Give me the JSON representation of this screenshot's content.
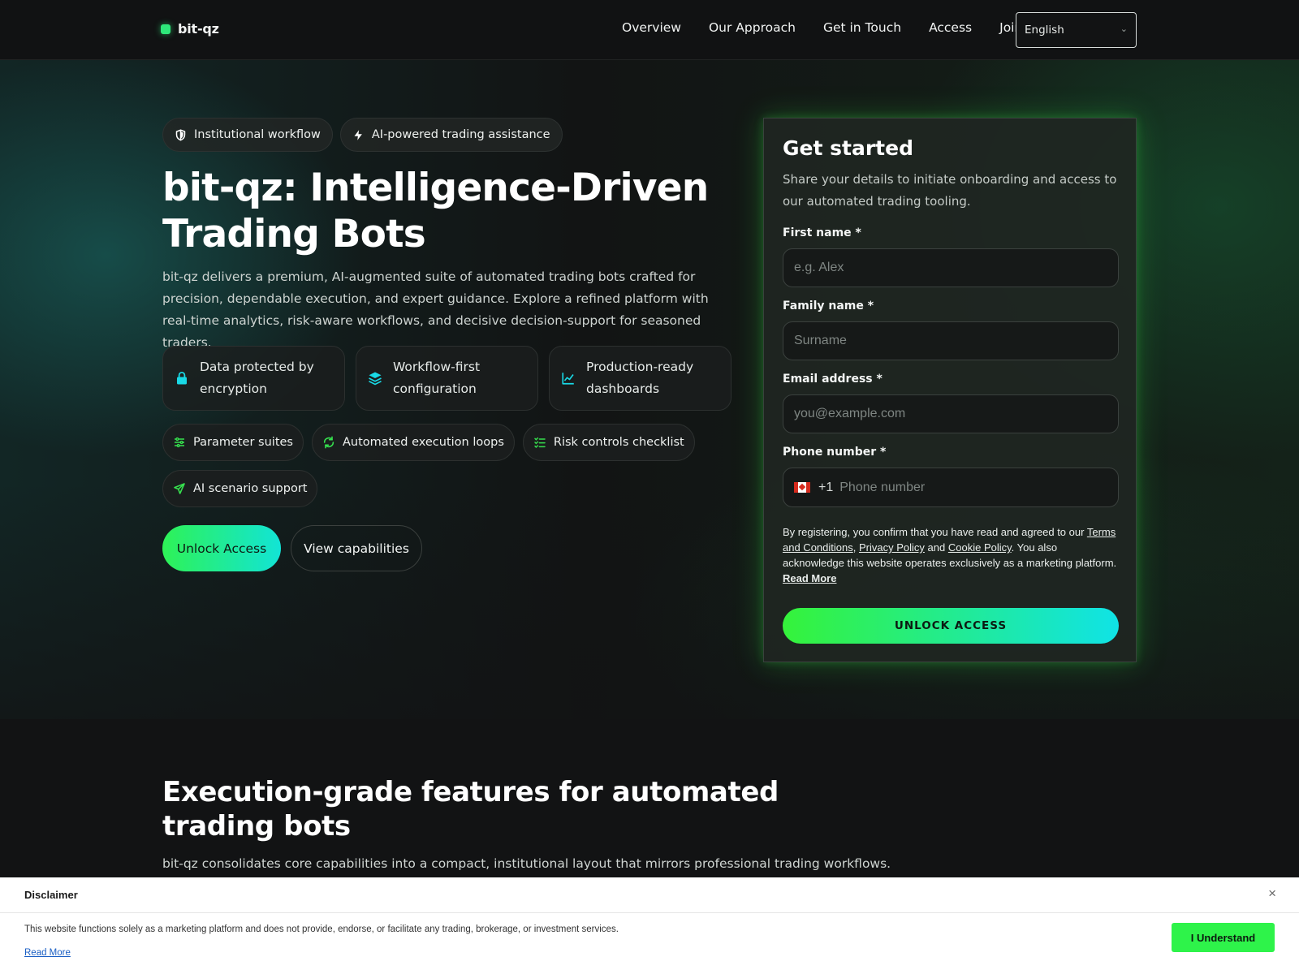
{
  "nav": {
    "brand": "bit-qz",
    "links": [
      "Overview",
      "Our Approach",
      "Get in Touch",
      "Access",
      "Join"
    ],
    "language": "English"
  },
  "hero": {
    "pills": [
      "Institutional workflow",
      "AI-powered trading assistance"
    ],
    "title": "bit-qz: Intelligence-Driven Trading Bots",
    "description": "bit-qz delivers a premium, AI-augmented suite of automated trading bots crafted for precision, dependable execution, and expert guidance. Explore a refined platform with real-time analytics, risk-aware workflows, and decisive decision-support for seasoned traders.",
    "cards": [
      "Data protected by encryption",
      "Workflow-first configuration",
      "Production-ready dashboards"
    ],
    "chips": [
      "Parameter suites",
      "Automated execution loops",
      "Risk controls checklist",
      "AI scenario support"
    ],
    "primary_button": "Unlock Access",
    "secondary_button": "View capabilities"
  },
  "form": {
    "title": "Get started",
    "subtitle": "Share your details to initiate onboarding and access to our automated trading tooling.",
    "first_name_label": "First name *",
    "first_name_placeholder": "e.g. Alex",
    "family_name_label": "Family name *",
    "family_name_placeholder": "Surname",
    "email_label": "Email address *",
    "email_placeholder": "you@example.com",
    "phone_label": "Phone number *",
    "phone_dial": "+1",
    "phone_placeholder": "Phone number",
    "legal_prefix": "By registering, you confirm that you have read and agreed to our",
    "terms": "Terms and Conditions",
    "comma": ",",
    "privacy": "Privacy Policy",
    "and": "and",
    "cookie": "Cookie Policy",
    "legal_suffix": ". You also acknowledge this website operates exclusively as a marketing platform.",
    "read_more": "Read More",
    "submit": "UNLOCK ACCESS"
  },
  "features_section": {
    "title": "Execution-grade features for automated trading bots",
    "description": "bit-qz consolidates core capabilities into a compact, institutional layout that mirrors professional trading workflows."
  },
  "disclaimer": {
    "title": "Disclaimer",
    "close": "×",
    "text": "This website functions solely as a marketing platform and does not provide, endorse, or facilitate any trading, brokerage, or investment services.",
    "read_more": "Read More",
    "button": "I Understand"
  },
  "colors": {
    "accent_green": "#2ef256",
    "accent_cyan": "#12e4d6",
    "background": "#121314"
  },
  "icons": [
    "shield-icon",
    "bolt-icon",
    "lock-icon",
    "layers-icon",
    "chart-line-icon",
    "sliders-icon",
    "refresh-icon",
    "checklist-icon",
    "send-icon",
    "chevron-down-icon",
    "close-icon",
    "canada-flag-icon"
  ]
}
